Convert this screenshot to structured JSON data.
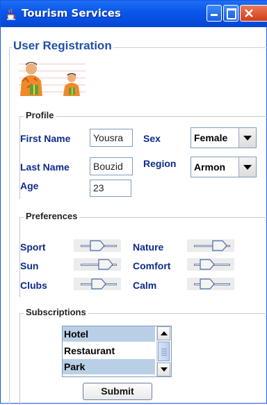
{
  "window": {
    "title": "Tourism Services"
  },
  "section": {
    "title": "User Registration"
  },
  "profile": {
    "legend": "Profile",
    "first_name_label": "First Name",
    "first_name_value": "Yousra",
    "last_name_label": "Last Name",
    "last_name_value": "Bouzid",
    "age_label": "Age",
    "age_value": "23",
    "sex_label": "Sex",
    "sex_value": "Female",
    "region_label": "Region",
    "region_value": "Armon"
  },
  "preferences": {
    "legend": "Preferences",
    "items": [
      {
        "label": "Sport"
      },
      {
        "label": "Nature"
      },
      {
        "label": "Sun"
      },
      {
        "label": "Comfort"
      },
      {
        "label": "Clubs"
      },
      {
        "label": "Calm"
      }
    ]
  },
  "subscriptions": {
    "legend": "Subscriptions",
    "items": [
      {
        "label": "Hotel",
        "selected": true
      },
      {
        "label": "Restaurant",
        "selected": false
      },
      {
        "label": "Park",
        "selected": true
      }
    ]
  },
  "submit_label": "Submit",
  "icons": {
    "app": "java-cup-icon",
    "logo": "tourists-icon",
    "minimize": "minimize-icon",
    "maximize": "maximize-icon",
    "close": "close-icon"
  },
  "colors": {
    "title_bar": "#0a58ea",
    "label": "#0e2a8c",
    "section_title": "#1f4fa8",
    "selection": "#b9cfe6"
  }
}
